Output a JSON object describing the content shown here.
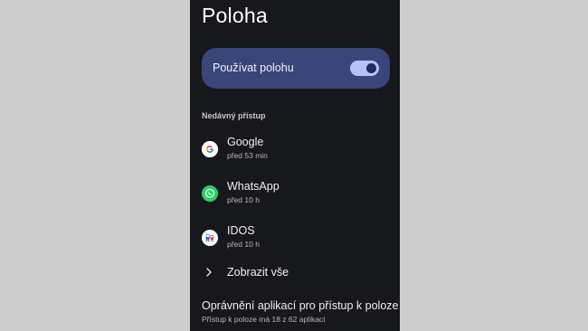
{
  "page": {
    "title": "Poloha"
  },
  "location_toggle": {
    "label": "Používat polohu",
    "state": "on"
  },
  "recent_access": {
    "header": "Nedávný přístup",
    "apps": [
      {
        "name": "Google",
        "time": "před 53 min",
        "icon": "google-icon"
      },
      {
        "name": "WhatsApp",
        "time": "před 10 h",
        "icon": "whatsapp-icon"
      },
      {
        "name": "IDOS",
        "time": "před 10 h",
        "icon": "idos-icon"
      }
    ],
    "show_all_label": "Zobrazit vše"
  },
  "permissions": {
    "title": "Oprávnění aplikací pro přístup k poloze",
    "subtitle": "Přístup k poloze má 18 z 62 aplikací"
  },
  "colors": {
    "screen_background": "#17181c",
    "page_background": "#cdcdcd",
    "card_background": "#3a4579",
    "switch_track": "#b7c2f6",
    "switch_knob": "#23295a",
    "whatsapp_green": "#25d366"
  }
}
